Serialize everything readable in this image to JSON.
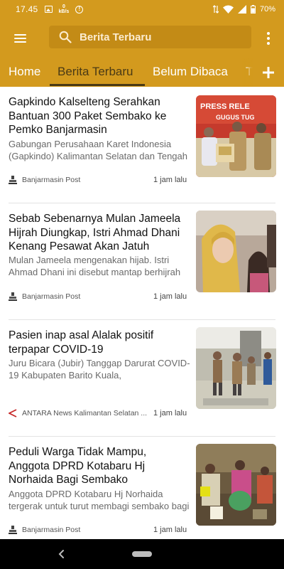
{
  "status_bar": {
    "time": "17.45",
    "net_speed_value": "0",
    "net_speed_unit": "kB/s",
    "battery": "70%"
  },
  "app_bar": {
    "search_placeholder": "Berita Terbaru"
  },
  "tabs": [
    {
      "label": "Home"
    },
    {
      "label": "Berita Terbaru",
      "active": true
    },
    {
      "label": "Belum Dibaca"
    },
    {
      "label": "T"
    }
  ],
  "articles": [
    {
      "title": "Gapkindo Kalselteng Serahkan Bantuan 300 Paket Sembako ke Pemko Banjarmasin",
      "description": "Gabungan Perusahaan Karet Indonesia (Gapkindo) Kalimantan Selatan dan Tengah",
      "source": "Banjarmasin Post",
      "time": "1 jam lalu",
      "thumb_text": "PRESS RELE... GUGUS TUG..."
    },
    {
      "title": "Sebab Sebenarnya Mulan Jameela Hijrah Diungkap, Istri Ahmad Dhani Kenang Pesawat Akan Jatuh",
      "description": "Mulan Jameela mengenakan hijab. Istri Ahmad Dhani ini disebut mantap berhijrah",
      "source": "Banjarmasin Post",
      "time": "1 jam lalu"
    },
    {
      "title": "Pasien inap asal Alalak positif terpapar COVID-19",
      "description": "Juru Bicara (Jubir) Tanggap Darurat COVID-19  Kabupaten Barito Kuala,",
      "source": "ANTARA News Kalimantan Selatan ...",
      "time": "1 jam lalu"
    },
    {
      "title": "Peduli Warga Tidak Mampu, Anggota DPRD Kotabaru Hj Norhaida Bagi Sembako",
      "description": "Anggota DPRD Kotabaru Hj Norhaida tergerak untuk turut membagi sembako bagi",
      "source": "Banjarmasin Post",
      "time": "1 jam lalu"
    }
  ],
  "colors": {
    "accent": "#d39a1e",
    "search_bg": "#c38b16",
    "tab_active": "#4a3a15"
  },
  "icons": [
    "menu-icon",
    "search-icon",
    "overflow-menu-icon",
    "add-icon",
    "back-icon",
    "home-pill-icon"
  ]
}
